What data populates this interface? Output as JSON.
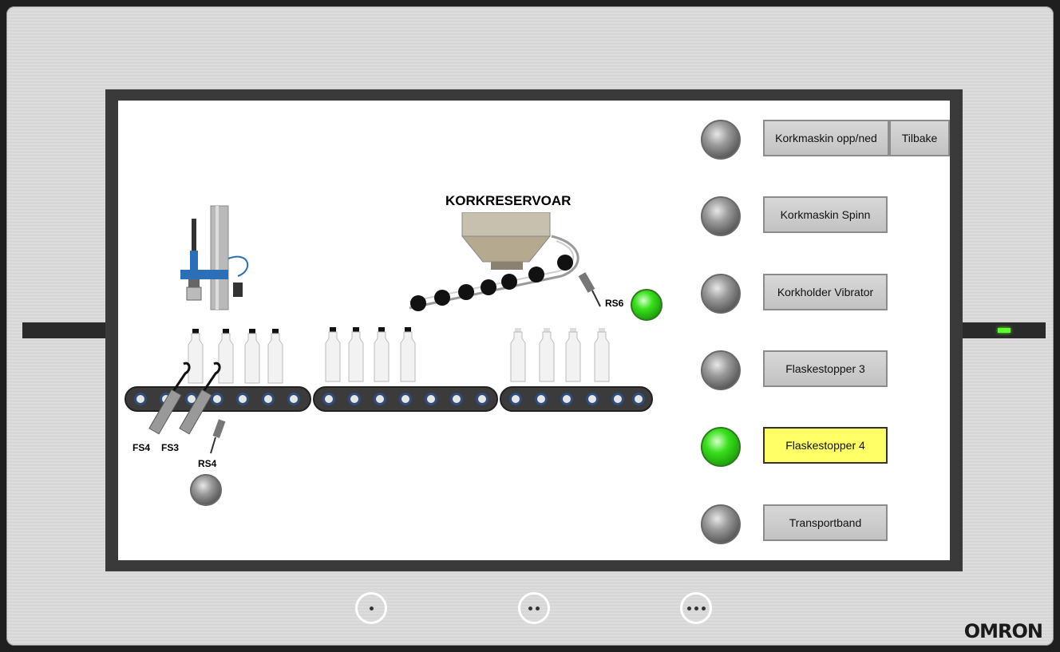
{
  "panel": {
    "brand": "OMRON",
    "status_led_color": "#5cff2a",
    "hardware_buttons": [
      {
        "id": "f1",
        "dots": 1
      },
      {
        "id": "f2",
        "dots": 2
      },
      {
        "id": "f3",
        "dots": 3
      }
    ]
  },
  "scene": {
    "reservoir_title": "KORKRESERVOAR",
    "sensors": {
      "fs4": "FS4",
      "fs3": "FS3",
      "rs4": "RS4",
      "rs6": "RS6"
    },
    "lamps": {
      "rs4": "off",
      "rs6": "on"
    }
  },
  "controls": [
    {
      "label": "Korkmaskin opp/ned",
      "lamp": "off",
      "active": false
    },
    {
      "label": "Korkmaskin Spinn",
      "lamp": "off",
      "active": false
    },
    {
      "label": "Korkholder Vibrator",
      "lamp": "off",
      "active": false
    },
    {
      "label": "Flaskestopper 3",
      "lamp": "off",
      "active": false
    },
    {
      "label": "Flaskestopper 4",
      "lamp": "on",
      "active": true
    },
    {
      "label": "Transportband",
      "lamp": "off",
      "active": false
    }
  ],
  "back_button": "Tilbake",
  "colors": {
    "active_button": "#ffff66",
    "lamp_on": "#39e01c",
    "lamp_off": "#8a8a8a"
  }
}
